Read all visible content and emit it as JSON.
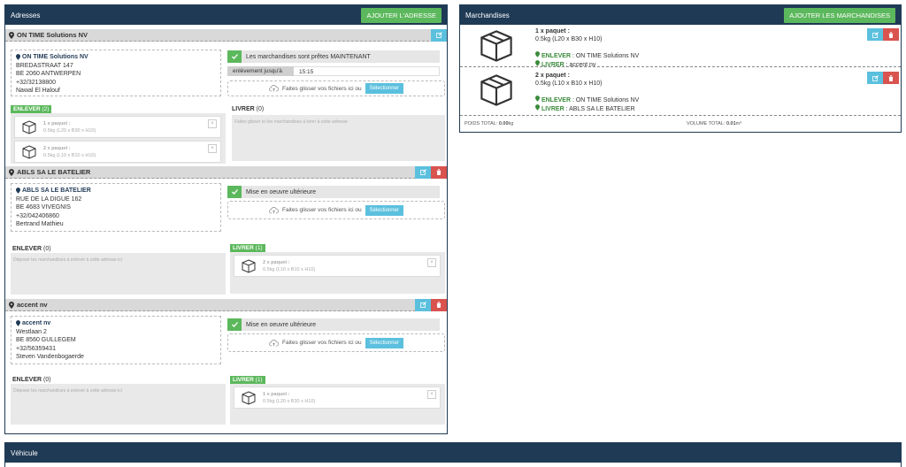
{
  "addresses_panel": {
    "title": "Adresses",
    "add_button": "AJOUTER L'ADRESSE",
    "addresses": [
      {
        "header": "ON TIME Solutions NV",
        "card": {
          "name": "ON TIME Solutions NV",
          "street": "BREDASTRAAT 147",
          "city": "BE 2060 ANTWERPEN",
          "phone": "+32/32138800",
          "contact": "Nawal El Halouf"
        },
        "status": "Les marchandises sont prêtes MAINTENANT",
        "pickup_label": "enlèvement jusqu'à",
        "pickup_time": "15:15",
        "dropzone_text": "Faites glisser vos fichiers ici ou",
        "dropzone_button": "Sélectionner",
        "enlever_label": "ENLEVER",
        "enlever_count": "(2)",
        "enlever_items": [
          {
            "qty": "1 x paquet :",
            "dims": "0.5kg (L20 x B30 x H10)"
          },
          {
            "qty": "2 x paquet :",
            "dims": "0.5kg (L10 x B10 x H10)"
          }
        ],
        "livrer_label": "LIVRER",
        "livrer_count": "(0)",
        "livrer_placeholder": "Faites glisser ici les marchandises à livrer à cette adresse"
      },
      {
        "header": "ABLS SA LE BATELIER",
        "card": {
          "name": "ABLS SA LE BATELIER",
          "street": "RUE DE LA DIGUE 162",
          "city": "BE 4683 VIVEGNIS",
          "phone": "+32/042406860",
          "contact": "Bertrand Mathieu"
        },
        "status": "Mise en oeuvre ultérieure",
        "dropzone_text": "Faites glisser vos fichiers ici ou",
        "dropzone_button": "Sélectionner",
        "enlever_label": "ENLEVER",
        "enlever_count": "(0)",
        "enlever_placeholder": "Déposer les marchandises à enlever à cette adresse ici",
        "livrer_label": "LIVRER",
        "livrer_count": "(1)",
        "livrer_items": [
          {
            "qty": "2 x paquet :",
            "dims": "0.5kg (L10 x B10 x H10)"
          }
        ]
      },
      {
        "header": "accent nv",
        "card": {
          "name": "accent nv",
          "street": "Westlaan 2",
          "city": "BE 8560 GULLEGEM",
          "phone": "+32/56359431",
          "contact": "Steven Vandenbogaerde"
        },
        "status": "Mise en oeuvre ultérieure",
        "dropzone_text": "Faites glisser vos fichiers ici ou",
        "dropzone_button": "Sélectionner",
        "enlever_label": "ENLEVER",
        "enlever_count": "(0)",
        "enlever_placeholder": "Déposer les marchandises à enlever à cette adresse ici",
        "livrer_label": "LIVRER",
        "livrer_count": "(1)",
        "livrer_items": [
          {
            "qty": "1 x paquet :",
            "dims": "0.5kg (L20 x B30 x H10)"
          }
        ]
      }
    ]
  },
  "merch_panel": {
    "title": "Marchandises",
    "add_button": "AJOUTER LES MARCHANDISES",
    "items": [
      {
        "qty": "1 x paquet :",
        "dims": "0.5kg (L20 x B30 x H10)",
        "enlever_label": "ENLEVER",
        "enlever_value": ": ON TIME Solutions NV",
        "livrer_label": "LIVRER",
        "livrer_value": ": accent nv"
      },
      {
        "qty": "2 x paquet :",
        "dims": "0.5kg (L10 x B10 x H10)",
        "enlever_label": "ENLEVER",
        "enlever_value": ": ON TIME Solutions NV",
        "livrer_label": "LIVRER",
        "livrer_value": ": ABLS SA LE BATELIER"
      }
    ],
    "weight_label": "POIDS TOTAL:",
    "weight_value": "0.00",
    "weight_unit": "kg",
    "volume_label": "VOLUME TOTAL:",
    "volume_value": "0.01",
    "volume_unit": "m³"
  },
  "vehicle_panel": {
    "title": "Véhicule"
  },
  "colors": {
    "navy": "#1f3a55",
    "green": "#5cb85c",
    "blue": "#5bc0de",
    "red": "#d9534f"
  },
  "icons": [
    "map-marker-icon",
    "check-icon",
    "cloud-upload-icon",
    "box-icon",
    "edit-icon",
    "trash-icon",
    "close-icon"
  ]
}
